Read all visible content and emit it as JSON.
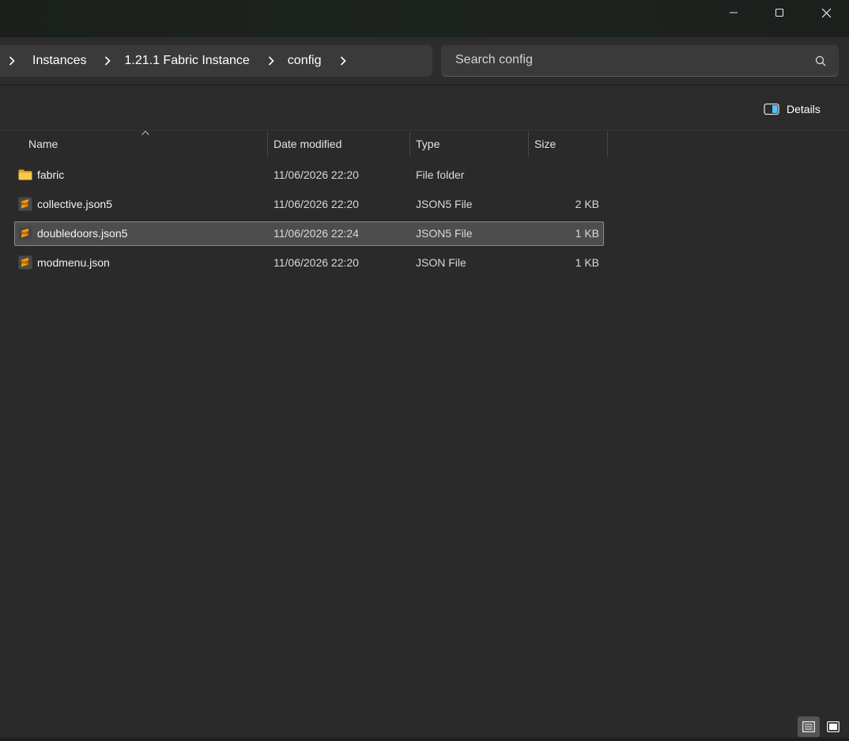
{
  "window": {
    "minimize_icon": "minimize-icon",
    "maximize_icon": "maximize-icon",
    "close_icon": "close-icon"
  },
  "breadcrumb": {
    "items": [
      "Instances",
      "1.21.1 Fabric Instance",
      "config"
    ]
  },
  "search": {
    "placeholder": "Search config"
  },
  "toolbar": {
    "details_label": "Details"
  },
  "columns": {
    "name": "Name",
    "date": "Date modified",
    "type": "Type",
    "size": "Size"
  },
  "files": [
    {
      "name": "fabric",
      "date": "11/06/2026 22:20",
      "type": "File folder",
      "size": "",
      "icon": "folder-icon"
    },
    {
      "name": "collective.json5",
      "date": "11/06/2026 22:20",
      "type": "JSON5 File",
      "size": "2 KB",
      "icon": "sublime-file-icon"
    },
    {
      "name": "doubledoors.json5",
      "date": "11/06/2026 22:24",
      "type": "JSON5 File",
      "size": "1 KB",
      "icon": "sublime-file-icon",
      "selected": true
    },
    {
      "name": "modmenu.json",
      "date": "11/06/2026 22:20",
      "type": "JSON File",
      "size": "1 KB",
      "icon": "sublime-file-icon"
    }
  ],
  "colors": {
    "background": "#2a2a2a",
    "selection": "#4d4d4d",
    "folder": "#f7c948",
    "sublime": "#ff9800",
    "details_accent": "#4cc2ff"
  }
}
